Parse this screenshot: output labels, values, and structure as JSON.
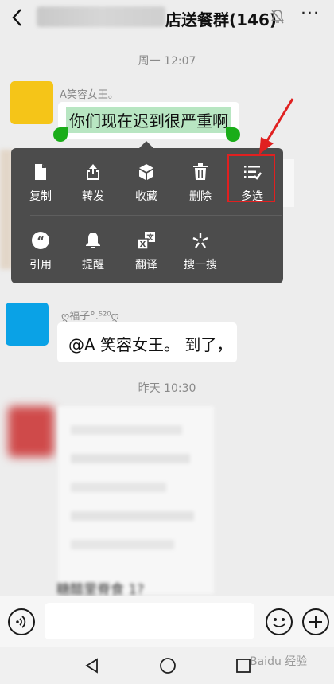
{
  "header": {
    "title": "店送餐群(146)",
    "back_icon": "back-chevron",
    "mute_icon": "bell-off",
    "more_label": "···"
  },
  "timestamps": [
    "周一 12:07",
    "昨天 10:30"
  ],
  "messages": [
    {
      "sender": "A笑容女王。",
      "text": "你们现在迟到很严重啊",
      "avatar_color": "#f5c518",
      "highlighted": true
    },
    {
      "sender": "ღ福子°.⁵²⁰ღ",
      "text": "@A 笑容女王。 到了，",
      "avatar_color": "#0aa2e6"
    }
  ],
  "popup": {
    "row1": [
      {
        "label": "复制",
        "icon": "copy-icon"
      },
      {
        "label": "转发",
        "icon": "forward-icon"
      },
      {
        "label": "收藏",
        "icon": "favorite-icon"
      },
      {
        "label": "删除",
        "icon": "delete-icon"
      },
      {
        "label": "多选",
        "icon": "multiselect-icon"
      }
    ],
    "row2": [
      {
        "label": "引用",
        "icon": "quote-icon"
      },
      {
        "label": "提醒",
        "icon": "remind-icon"
      },
      {
        "label": "翻译",
        "icon": "translate-icon"
      },
      {
        "label": "搜一搜",
        "icon": "search-icon"
      }
    ]
  },
  "blurred_text": "糖醋里脊食 1?",
  "watermark": "Baidu 经验",
  "colors": {
    "background": "#ededed",
    "popup": "#4c4c4c",
    "selection": "#b8e6c2",
    "handle": "#1aad19",
    "annotation": "#e02020"
  }
}
